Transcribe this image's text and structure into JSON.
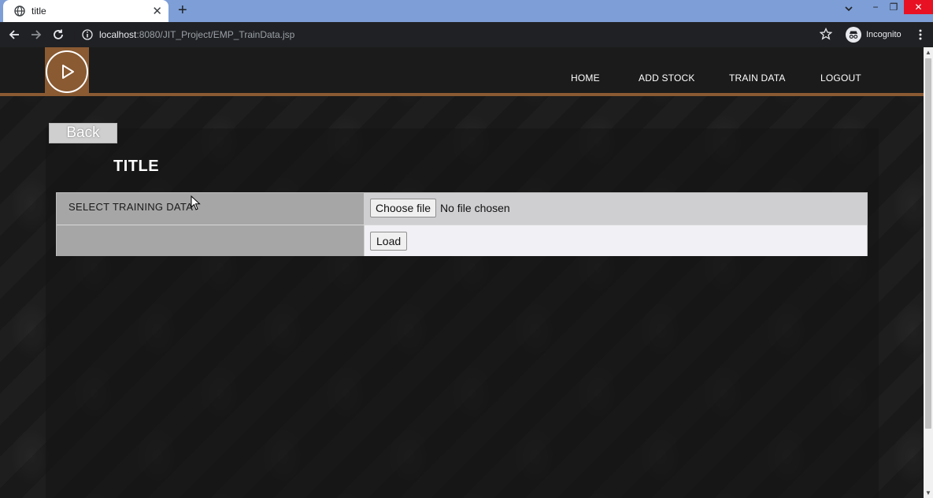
{
  "browser": {
    "tab_title": "title",
    "tab_close": "✕",
    "new_tab": "+",
    "url_host": "localhost",
    "url_rest": ":8080/JIT_Project/EMP_TrainData.jsp",
    "profile_label": "Incognito",
    "window_min": "−",
    "window_max": "❐",
    "window_close": "✕"
  },
  "site": {
    "nav": {
      "home": "HOME",
      "add_stock": "ADD STOCK",
      "train_data": "TRAIN DATA",
      "logout": "LOGOUT"
    },
    "back_label": "Back",
    "title": "TITLE"
  },
  "form": {
    "select_label": "SELECT TRAINING DATA",
    "file_button": "Choose file",
    "file_status": "No file chosen",
    "load_button": "Load"
  },
  "colors": {
    "header_accent": "#8a5a32",
    "tabstrip": "#7d9ed6",
    "close_red": "#e81123"
  }
}
